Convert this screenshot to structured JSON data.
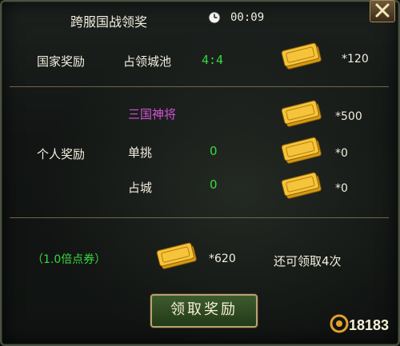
{
  "header": {
    "title": "跨服国战领奖",
    "time": "00:09"
  },
  "country_reward": {
    "label": "国家奖励",
    "item_label": "占领城池",
    "score": "4:4",
    "amount": "*120"
  },
  "personal_reward": {
    "label": "个人奖励",
    "rows": [
      {
        "name": "三国神将",
        "value": "",
        "amount": "*500"
      },
      {
        "name": "单挑",
        "value": "0",
        "amount": "*0"
      },
      {
        "name": "占城",
        "value": "0",
        "amount": "*0"
      }
    ]
  },
  "total": {
    "multiplier_label": "（1.0倍点券）",
    "amount": "*620",
    "remaining": "还可领取4次"
  },
  "actions": {
    "claim_label": "领取奖励"
  },
  "watermark": "18183",
  "colors": {
    "green": "#39d83f",
    "purple": "#d553d8",
    "text": "#f2eedf",
    "ticket": "#f2b51e"
  },
  "icons": {
    "clock": "clock-icon",
    "close": "close-icon",
    "ticket": "gold-ticket-icon"
  }
}
